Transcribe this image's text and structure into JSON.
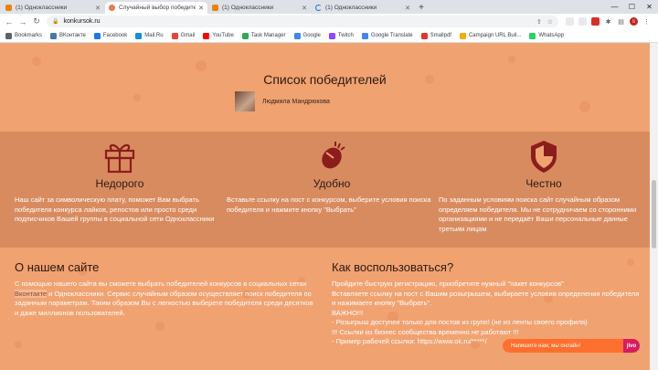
{
  "browser": {
    "tabs": [
      {
        "title": "(1) Одноклассники",
        "favicon": "odnoklassniki-icon",
        "active": false
      },
      {
        "title": "Случайный выбор победителя",
        "favicon": "konkursok-icon",
        "active": true
      },
      {
        "title": "(1) Одноклассники",
        "favicon": "odnoklassniki-icon",
        "active": false
      },
      {
        "title": "(1) Одноклассники",
        "favicon": "loading-icon",
        "active": false
      }
    ],
    "close_glyph": "✕",
    "new_tab_glyph": "+",
    "window_controls": [
      "—",
      "☐",
      "✕"
    ],
    "url": "konkursok.ru",
    "nav": {
      "back": "←",
      "forward": "→",
      "reload": "↻"
    },
    "bookmarks": [
      {
        "label": "Bookmarks",
        "color": "#5f6368"
      },
      {
        "label": "ВКонтакте",
        "color": "#4a76a8"
      },
      {
        "label": "Facebook",
        "color": "#1877f2"
      },
      {
        "label": "Mail.Ru",
        "color": "#168de2"
      },
      {
        "label": "Gmail",
        "color": "#ea4335"
      },
      {
        "label": "YouTube",
        "color": "#ff0000"
      },
      {
        "label": "Task Manager",
        "color": "#34a853"
      },
      {
        "label": "Google",
        "color": "#4285f4"
      },
      {
        "label": "Twitch",
        "color": "#9146ff"
      },
      {
        "label": "Google Translate",
        "color": "#4285f4"
      },
      {
        "label": "Smallpdf",
        "color": "#e5322d"
      },
      {
        "label": "Campaign URL Buil...",
        "color": "#f9ab00"
      },
      {
        "label": "WhatsApp",
        "color": "#25d366"
      }
    ]
  },
  "page": {
    "winners_title": "Список победителей",
    "winner_name": "Людмила Мандрюкова",
    "features": [
      {
        "icon": "gift-icon",
        "title": "Недорого",
        "text": "Наш сайт за символическую плату, поможет Вам выбрать победителя конкурса лайков, репостов или просто среди подписчиков Вашей группы в социальной сети Одноклассники"
      },
      {
        "icon": "mouse-click-icon",
        "title": "Удобно",
        "text": "Вставьте ссылку на пост с конкурсом, выберите условия поиска победителя и нажмите кнопку \"Выбрать\""
      },
      {
        "icon": "shield-icon",
        "title": "Честно",
        "text": "По заданным условиям поиска сайт случайным образом определяем победителя. Мы не сотрудничаем со сторонними организациями и не передаёт Ваши персональные данные третьим лицам"
      }
    ],
    "about": {
      "title": "О нашем сайте",
      "text_before": "С помощью нашего сайта вы сможете выбрать победителей конкурсов в социальных сетях ",
      "link": "Вконтакте",
      "text_after": " и Одноклассники. Сервис случайным образом осуществляет поиск победителя по заданным параметрам. Таким образом Вы с легкостью выберете победителя среди десятков и даже миллионов пользователей."
    },
    "how": {
      "title": "Как воспользоваться?",
      "lines": [
        "Пройдите быструю регистрацию, приобретите нужный \"пакет конкурсов\"",
        "Вставляете ссылку на пост с Вашим розыгрышем, выбираете условия определения победителя и нажимаете кнопку \"Выбрать\".",
        "ВАЖНО!!!",
        "- Розыгрыш доступен только для постов из групп! (не из ленты своего профиля)",
        "!!! Ссылки из бизнес сообщества временно не работают !!!",
        "- Пример рабочей ссылки: https://www.ok.ru/*****/"
      ]
    },
    "chat": {
      "label": "Напишите нам, мы онлайн!",
      "brand": "jivo"
    }
  }
}
